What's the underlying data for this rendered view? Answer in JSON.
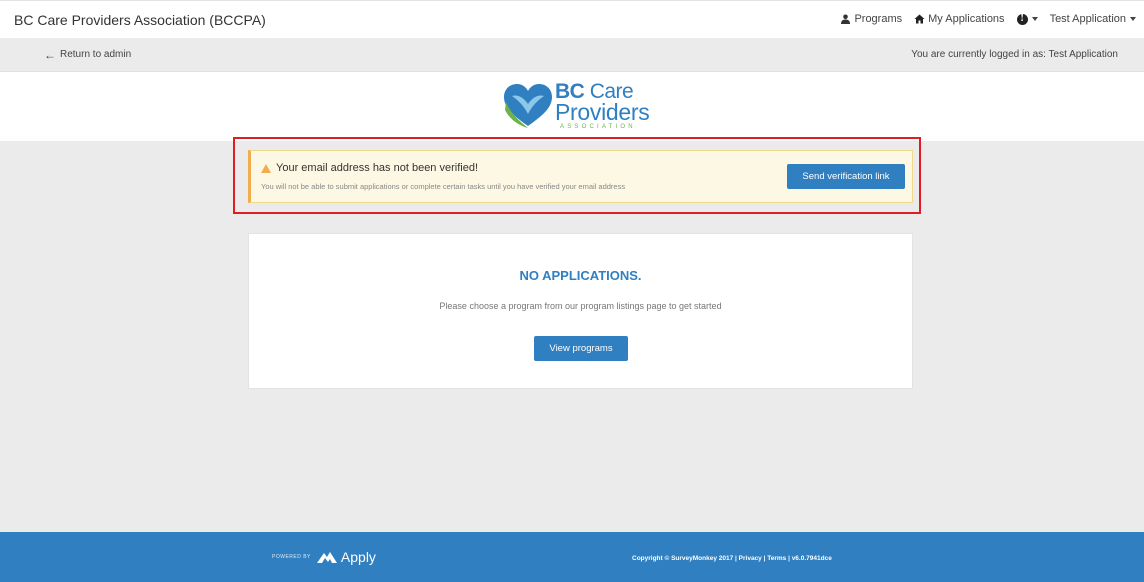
{
  "header": {
    "brand": "BC Care Providers Association (BCCPA)",
    "nav": {
      "programs": "Programs",
      "my_applications": "My Applications",
      "user": "Test Application"
    }
  },
  "admin_bar": {
    "return_label": "Return to admin",
    "logged_in_text": "You are currently logged in as: Test Application"
  },
  "logo": {
    "bc": "BC",
    "care": "Care",
    "providers": "Providers",
    "association": "ASSOCIATION"
  },
  "alert": {
    "title": "Your email address has not been verified!",
    "subtitle": "You will not be able to submit applications or complete certain tasks until you have verified your email address",
    "button_label": "Send verification link"
  },
  "applications": {
    "title": "NO APPLICATIONS.",
    "text": "Please choose a program from our program listings page to get started",
    "button_label": "View programs"
  },
  "footer": {
    "powered_by": "POWERED BY",
    "apply": "Apply",
    "copyright": "Copyright © SurveyMonkey 2017 | Privacy | Terms | v6.0.7941dce"
  },
  "colors": {
    "primary": "#2f7fc1",
    "alert_bg": "#fcf8e3",
    "warning": "#f0ad4e",
    "highlight": "#e31b23",
    "logo_green": "#6db34a"
  }
}
